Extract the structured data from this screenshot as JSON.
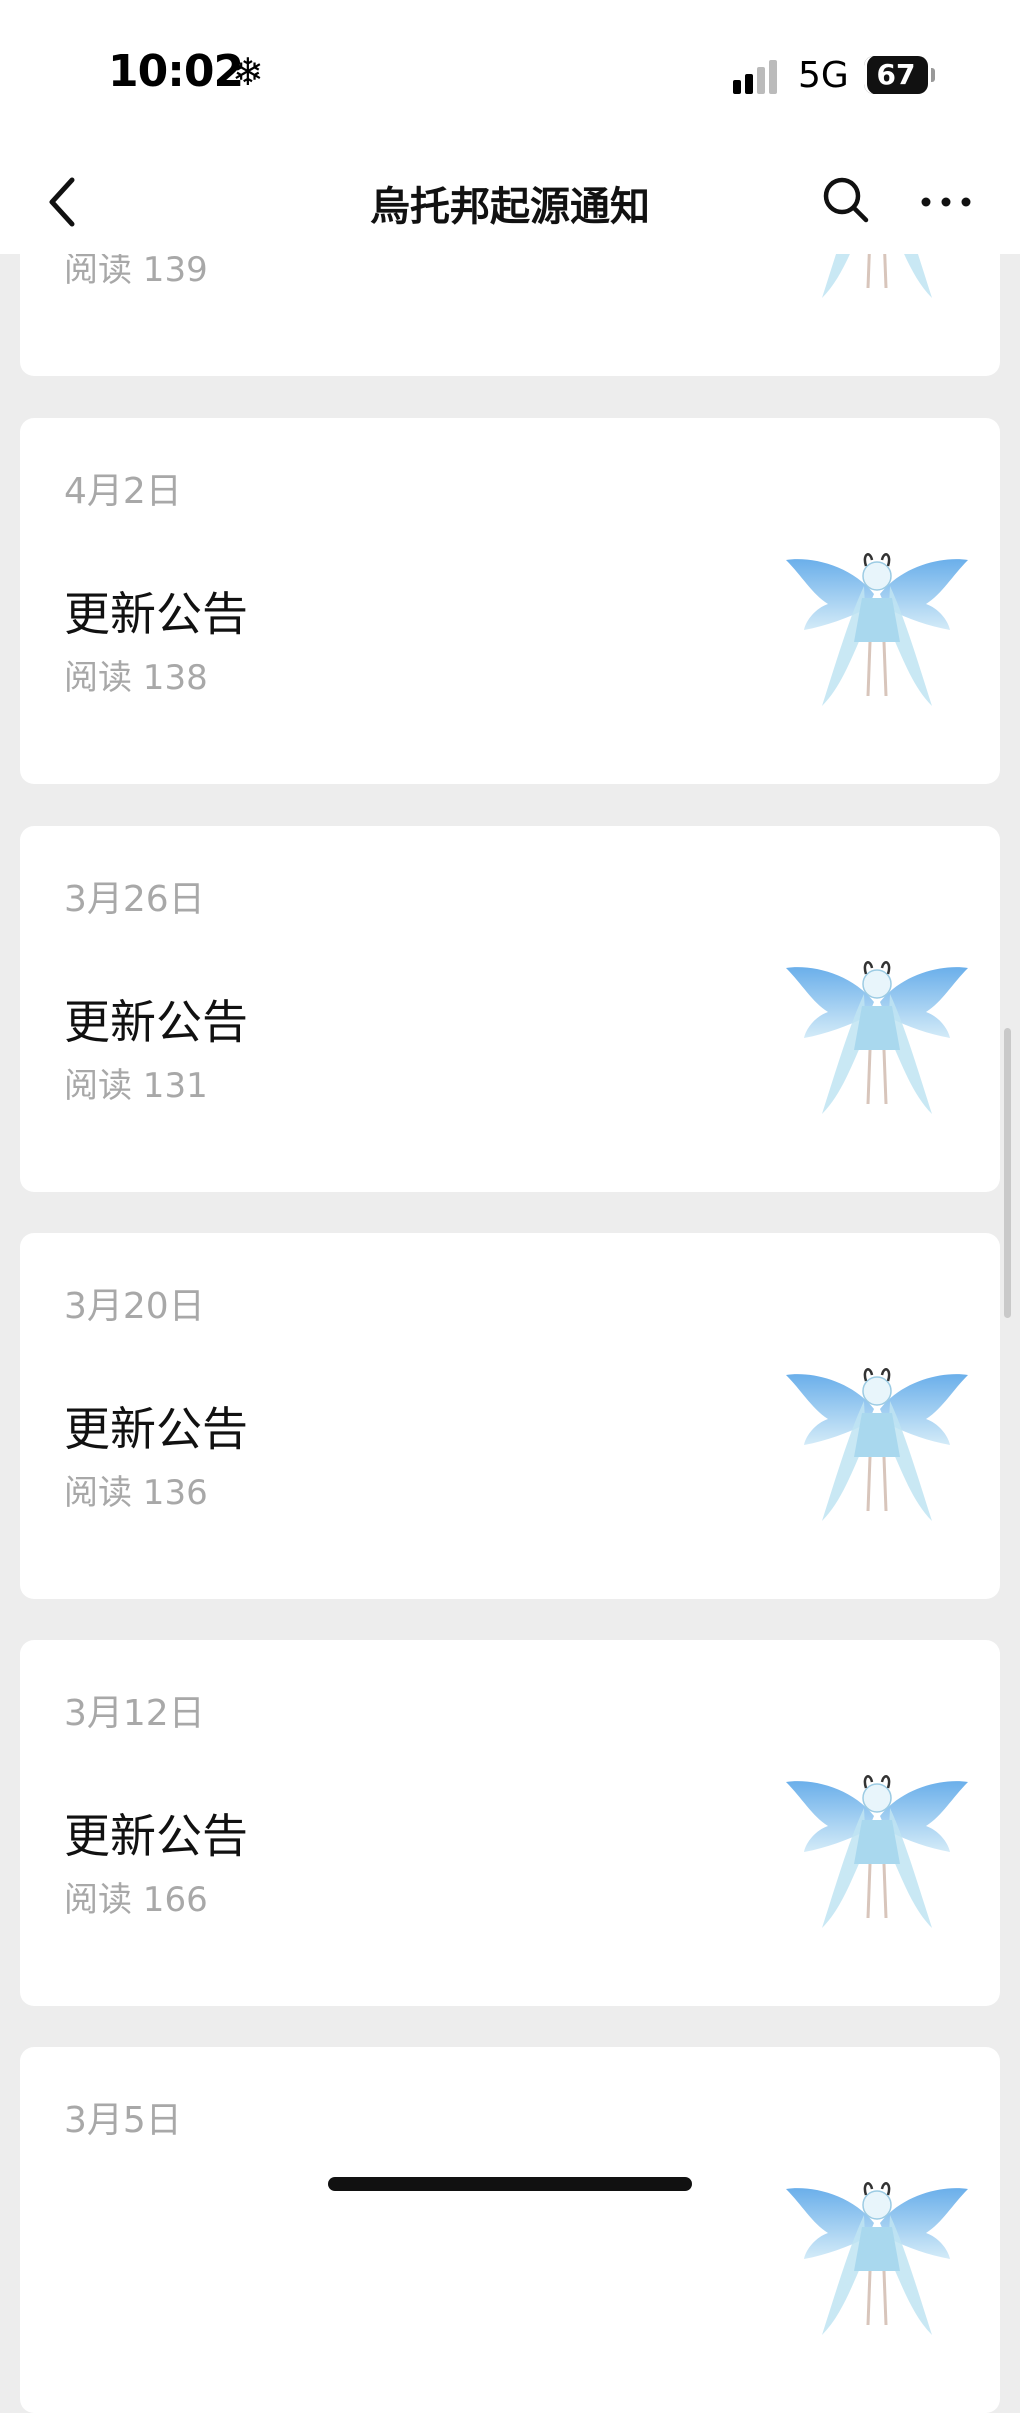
{
  "status": {
    "time": "10:02",
    "network": "5G",
    "battery": "67"
  },
  "nav": {
    "title": "烏托邦起源通知"
  },
  "articles": [
    {
      "date": "",
      "title": "",
      "reads": "阅读 139"
    },
    {
      "date": "4月2日",
      "title": "更新公告",
      "reads": "阅读 138"
    },
    {
      "date": "3月26日",
      "title": "更新公告",
      "reads": "阅读 131"
    },
    {
      "date": "3月20日",
      "title": "更新公告",
      "reads": "阅读 136"
    },
    {
      "date": "3月12日",
      "title": "更新公告",
      "reads": "阅读 166"
    },
    {
      "date": "3月5日",
      "title": "",
      "reads": ""
    }
  ],
  "icons": {
    "back": "back-icon",
    "search": "search-icon",
    "more": "more-icon",
    "thumbnail": "fairy-thumbnail-image"
  },
  "colors": {
    "background": "#ededed",
    "card": "#ffffff",
    "muted_text": "#a8a8a8",
    "title_text": "#111111"
  }
}
